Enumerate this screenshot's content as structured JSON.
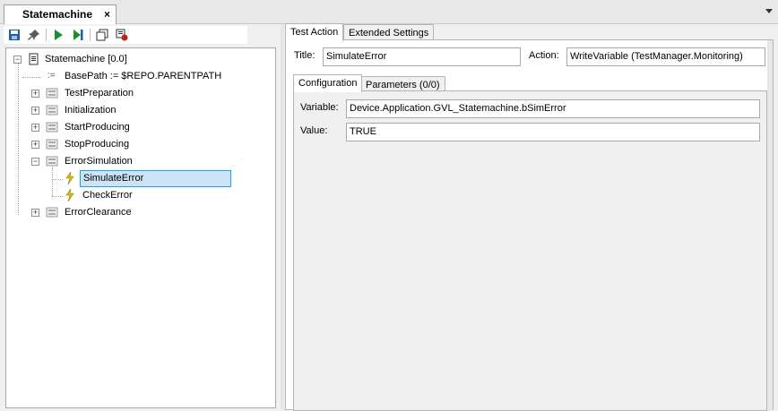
{
  "document_tab": {
    "title": "Statemachine",
    "close": "×"
  },
  "toolbar": {
    "buttons": [
      {
        "icon": "save-icon"
      },
      {
        "icon": "pin-icon"
      },
      {
        "icon": "play-icon"
      },
      {
        "icon": "step-icon"
      },
      {
        "icon": "copy-icon"
      },
      {
        "icon": "breakpoint-icon"
      }
    ]
  },
  "tree": {
    "root": "Statemachine [0.0]",
    "items": [
      {
        "label": "BasePath := $REPO.PARENTPATH",
        "icon": "assignment-icon",
        "expander": ""
      },
      {
        "label": "TestPreparation",
        "icon": "sequence-icon",
        "expander": "+"
      },
      {
        "label": "Initialization",
        "icon": "sequence-icon",
        "expander": "+"
      },
      {
        "label": "StartProducing",
        "icon": "sequence-icon",
        "expander": "+"
      },
      {
        "label": "StopProducing",
        "icon": "sequence-icon",
        "expander": "+"
      },
      {
        "label": "ErrorSimulation",
        "icon": "sequence-icon",
        "expander": "−"
      },
      {
        "label": "SimulateError",
        "icon": "action-icon",
        "expander": "",
        "selected": true
      },
      {
        "label": "CheckError",
        "icon": "action-icon",
        "expander": ""
      },
      {
        "label": "ErrorClearance",
        "icon": "sequence-icon",
        "expander": "+"
      }
    ]
  },
  "right": {
    "tabs": {
      "test_action": "Test Action",
      "extended_settings": "Extended Settings"
    },
    "title_label": "Title:",
    "title_value": "SimulateError",
    "action_label": "Action:",
    "action_value": "WriteVariable (TestManager.Monitoring)",
    "inner_tabs": {
      "configuration": "Configuration",
      "parameters": "Parameters (0/0)"
    },
    "variable_label": "Variable:",
    "variable_value": "Device.Application.GVL_Statemachine.bSimError",
    "value_label": "Value:",
    "value_value": "TRUE"
  },
  "colors": {
    "selection_bg": "#cce4f7",
    "selection_border": "#26a0da",
    "save_blue": "#1f5fa8",
    "play_green": "#1b8f2e",
    "action_yellow": "#d9c400",
    "breakpoint_red": "#b02a1a"
  }
}
